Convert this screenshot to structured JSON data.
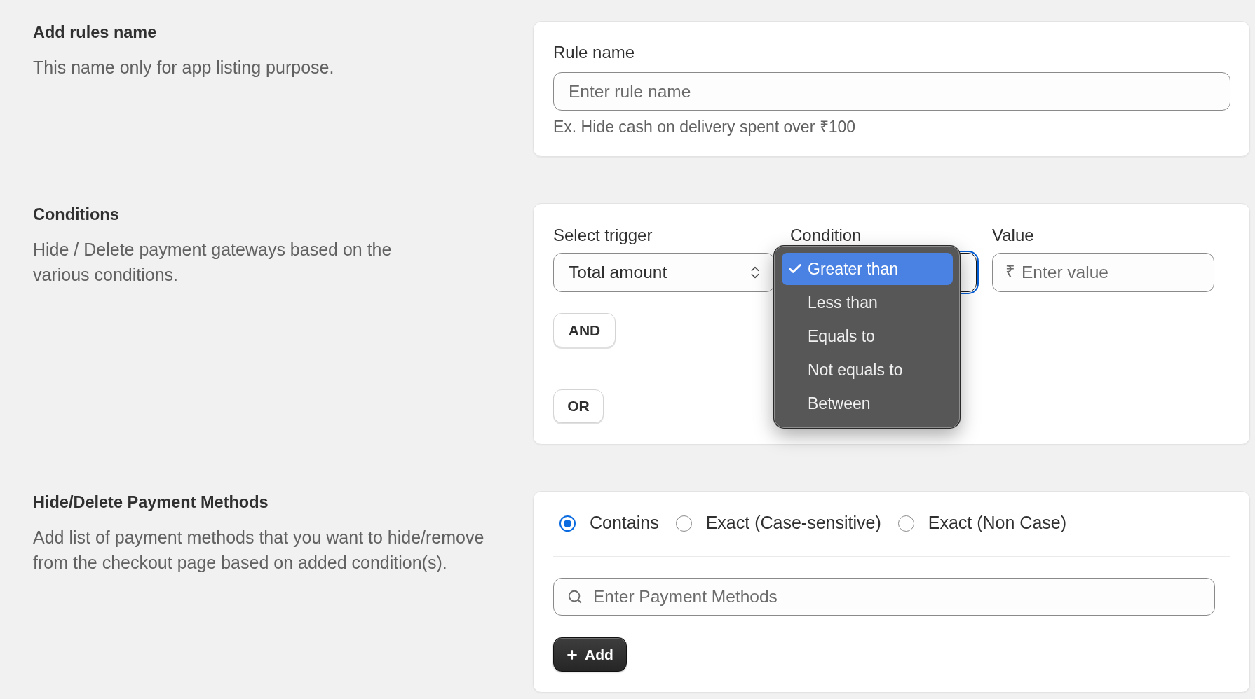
{
  "rule_name_section": {
    "heading": "Add rules name",
    "description": "This name only for app listing purpose.",
    "field": {
      "label": "Rule name",
      "placeholder": "Enter rule name",
      "hint": "Ex. Hide cash on delivery spent over ₹100"
    }
  },
  "conditions_section": {
    "heading": "Conditions",
    "description": "Hide / Delete payment gateways based on the various conditions.",
    "trigger": {
      "label": "Select trigger",
      "value": "Total amount"
    },
    "condition": {
      "label": "Condition",
      "focused": true,
      "expanded": true,
      "menu": {
        "options": [
          {
            "label": "Greater than",
            "selected": true
          },
          {
            "label": "Less than",
            "selected": false
          },
          {
            "label": "Equals to",
            "selected": false
          },
          {
            "label": "Not equals to",
            "selected": false
          },
          {
            "label": "Between",
            "selected": false
          }
        ]
      }
    },
    "value": {
      "label": "Value",
      "prefix": "₹",
      "placeholder": "Enter value"
    },
    "and_button": "AND",
    "or_button": "OR"
  },
  "payment_methods_section": {
    "heading": "Hide/Delete Payment Methods",
    "description": "Add list of payment methods that you want to hide/remove from the checkout page based on added condition(s).",
    "match_options": [
      {
        "label": "Contains",
        "selected": true
      },
      {
        "label": "Exact (Case-sensitive)",
        "selected": false
      },
      {
        "label": "Exact (Non Case)",
        "selected": false
      }
    ],
    "search": {
      "placeholder": "Enter Payment Methods"
    },
    "add_button": "Add"
  }
}
